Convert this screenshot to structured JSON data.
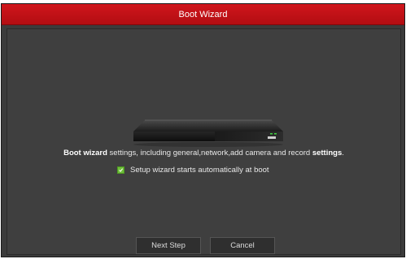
{
  "window": {
    "title": "Boot Wizard"
  },
  "main": {
    "description_bold_1": "Boot wizard",
    "description_mid": " settings, including general,network,add camera and record ",
    "description_bold_2": "settings",
    "description_end": ".",
    "device_icon": "nvr-device-icon",
    "auto_start_checkbox": {
      "label": "Setup wizard starts automatically at boot",
      "checked": true,
      "color": "#6fbf3a"
    }
  },
  "footer": {
    "next_label": "Next Step",
    "cancel_label": "Cancel"
  },
  "colors": {
    "titlebar": "#c8141a",
    "background": "#3f3f3f"
  }
}
